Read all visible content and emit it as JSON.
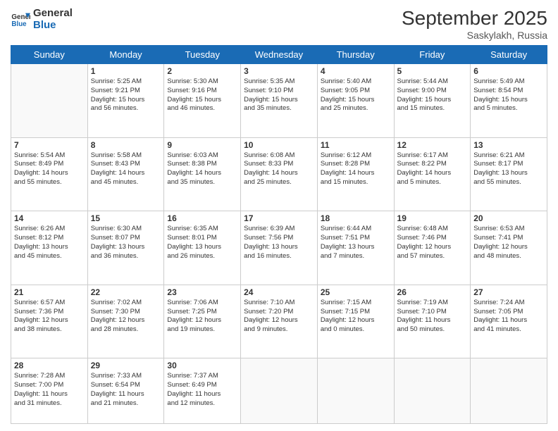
{
  "header": {
    "logo_line1": "General",
    "logo_line2": "Blue",
    "month": "September 2025",
    "location": "Saskylakh, Russia"
  },
  "weekdays": [
    "Sunday",
    "Monday",
    "Tuesday",
    "Wednesday",
    "Thursday",
    "Friday",
    "Saturday"
  ],
  "weeks": [
    [
      {
        "day": "",
        "info": ""
      },
      {
        "day": "1",
        "info": "Sunrise: 5:25 AM\nSunset: 9:21 PM\nDaylight: 15 hours\nand 56 minutes."
      },
      {
        "day": "2",
        "info": "Sunrise: 5:30 AM\nSunset: 9:16 PM\nDaylight: 15 hours\nand 46 minutes."
      },
      {
        "day": "3",
        "info": "Sunrise: 5:35 AM\nSunset: 9:10 PM\nDaylight: 15 hours\nand 35 minutes."
      },
      {
        "day": "4",
        "info": "Sunrise: 5:40 AM\nSunset: 9:05 PM\nDaylight: 15 hours\nand 25 minutes."
      },
      {
        "day": "5",
        "info": "Sunrise: 5:44 AM\nSunset: 9:00 PM\nDaylight: 15 hours\nand 15 minutes."
      },
      {
        "day": "6",
        "info": "Sunrise: 5:49 AM\nSunset: 8:54 PM\nDaylight: 15 hours\nand 5 minutes."
      }
    ],
    [
      {
        "day": "7",
        "info": "Sunrise: 5:54 AM\nSunset: 8:49 PM\nDaylight: 14 hours\nand 55 minutes."
      },
      {
        "day": "8",
        "info": "Sunrise: 5:58 AM\nSunset: 8:43 PM\nDaylight: 14 hours\nand 45 minutes."
      },
      {
        "day": "9",
        "info": "Sunrise: 6:03 AM\nSunset: 8:38 PM\nDaylight: 14 hours\nand 35 minutes."
      },
      {
        "day": "10",
        "info": "Sunrise: 6:08 AM\nSunset: 8:33 PM\nDaylight: 14 hours\nand 25 minutes."
      },
      {
        "day": "11",
        "info": "Sunrise: 6:12 AM\nSunset: 8:28 PM\nDaylight: 14 hours\nand 15 minutes."
      },
      {
        "day": "12",
        "info": "Sunrise: 6:17 AM\nSunset: 8:22 PM\nDaylight: 14 hours\nand 5 minutes."
      },
      {
        "day": "13",
        "info": "Sunrise: 6:21 AM\nSunset: 8:17 PM\nDaylight: 13 hours\nand 55 minutes."
      }
    ],
    [
      {
        "day": "14",
        "info": "Sunrise: 6:26 AM\nSunset: 8:12 PM\nDaylight: 13 hours\nand 45 minutes."
      },
      {
        "day": "15",
        "info": "Sunrise: 6:30 AM\nSunset: 8:07 PM\nDaylight: 13 hours\nand 36 minutes."
      },
      {
        "day": "16",
        "info": "Sunrise: 6:35 AM\nSunset: 8:01 PM\nDaylight: 13 hours\nand 26 minutes."
      },
      {
        "day": "17",
        "info": "Sunrise: 6:39 AM\nSunset: 7:56 PM\nDaylight: 13 hours\nand 16 minutes."
      },
      {
        "day": "18",
        "info": "Sunrise: 6:44 AM\nSunset: 7:51 PM\nDaylight: 13 hours\nand 7 minutes."
      },
      {
        "day": "19",
        "info": "Sunrise: 6:48 AM\nSunset: 7:46 PM\nDaylight: 12 hours\nand 57 minutes."
      },
      {
        "day": "20",
        "info": "Sunrise: 6:53 AM\nSunset: 7:41 PM\nDaylight: 12 hours\nand 48 minutes."
      }
    ],
    [
      {
        "day": "21",
        "info": "Sunrise: 6:57 AM\nSunset: 7:36 PM\nDaylight: 12 hours\nand 38 minutes."
      },
      {
        "day": "22",
        "info": "Sunrise: 7:02 AM\nSunset: 7:30 PM\nDaylight: 12 hours\nand 28 minutes."
      },
      {
        "day": "23",
        "info": "Sunrise: 7:06 AM\nSunset: 7:25 PM\nDaylight: 12 hours\nand 19 minutes."
      },
      {
        "day": "24",
        "info": "Sunrise: 7:10 AM\nSunset: 7:20 PM\nDaylight: 12 hours\nand 9 minutes."
      },
      {
        "day": "25",
        "info": "Sunrise: 7:15 AM\nSunset: 7:15 PM\nDaylight: 12 hours\nand 0 minutes."
      },
      {
        "day": "26",
        "info": "Sunrise: 7:19 AM\nSunset: 7:10 PM\nDaylight: 11 hours\nand 50 minutes."
      },
      {
        "day": "27",
        "info": "Sunrise: 7:24 AM\nSunset: 7:05 PM\nDaylight: 11 hours\nand 41 minutes."
      }
    ],
    [
      {
        "day": "28",
        "info": "Sunrise: 7:28 AM\nSunset: 7:00 PM\nDaylight: 11 hours\nand 31 minutes."
      },
      {
        "day": "29",
        "info": "Sunrise: 7:33 AM\nSunset: 6:54 PM\nDaylight: 11 hours\nand 21 minutes."
      },
      {
        "day": "30",
        "info": "Sunrise: 7:37 AM\nSunset: 6:49 PM\nDaylight: 11 hours\nand 12 minutes."
      },
      {
        "day": "",
        "info": ""
      },
      {
        "day": "",
        "info": ""
      },
      {
        "day": "",
        "info": ""
      },
      {
        "day": "",
        "info": ""
      }
    ]
  ]
}
